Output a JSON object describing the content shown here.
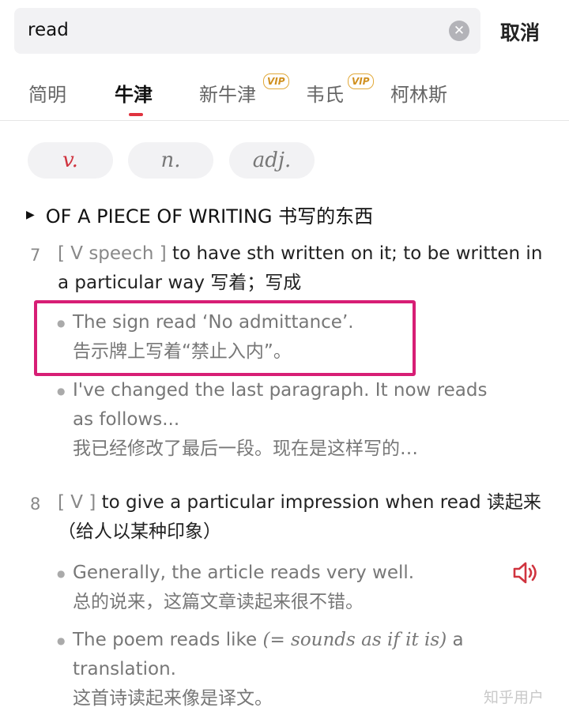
{
  "search": {
    "query": "read",
    "cancel_label": "取消"
  },
  "tabs": [
    {
      "label": "简明",
      "active": false,
      "vip": false
    },
    {
      "label": "牛津",
      "active": true,
      "vip": false
    },
    {
      "label": "新牛津",
      "active": false,
      "vip": true
    },
    {
      "label": "韦氏",
      "active": false,
      "vip": true
    },
    {
      "label": "柯林斯",
      "active": false,
      "vip": false
    }
  ],
  "vip_badge": "VIP",
  "pos_filters": [
    {
      "label": "v.",
      "active": true
    },
    {
      "label": "n.",
      "active": false
    },
    {
      "label": "adj.",
      "active": false
    }
  ],
  "section": {
    "title": "OF A PIECE OF WRITING 书写的东西"
  },
  "senses": [
    {
      "number": "7",
      "grammar": "[ V speech ]",
      "definition": "to have sth written on it; to be written in a particular way 写着；写成",
      "examples": [
        {
          "en": "The sign read ‘No admittance’.",
          "zh": "告示牌上写着“禁止入内”。"
        },
        {
          "en": "I've changed the last paragraph. It now reads as follows...",
          "zh": "我已经修改了最后一段。现在是这样写的…"
        }
      ]
    },
    {
      "number": "8",
      "grammar": "[ V ]",
      "definition": "to give a particular impression when read 读起来（给人以某种印象）",
      "examples": [
        {
          "en": "Generally, the article reads very well.",
          "zh": "总的说来，这篇文章读起来很不错。"
        },
        {
          "en_before": "The poem reads like ",
          "gloss": "(= sounds as if it is)",
          "en_after": " a translation.",
          "zh": "这首诗读起来像是译文。"
        }
      ]
    }
  ],
  "watermark": "知乎用户",
  "colors": {
    "accent": "#e0333f",
    "highlight": "#d71e75",
    "vip": "#e2a93a"
  }
}
